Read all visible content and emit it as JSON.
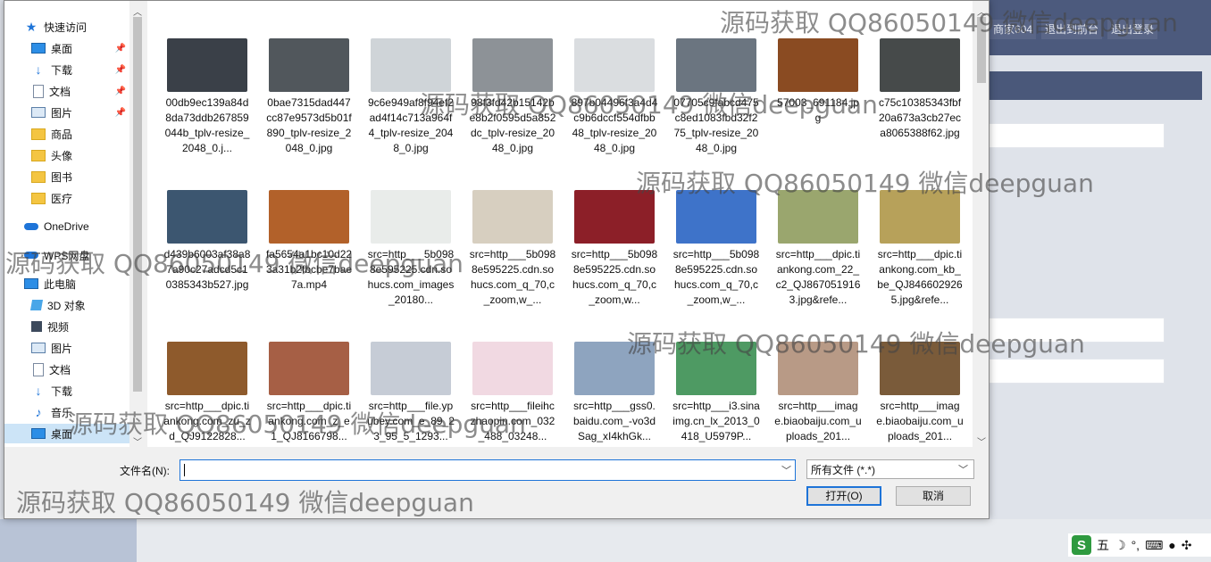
{
  "background": {
    "top_links": [
      "商家604",
      "退出到前台",
      "退出登录"
    ]
  },
  "nav": {
    "items": [
      {
        "label": "快速访问",
        "icon": "star-icon",
        "pinned": false
      },
      {
        "label": "桌面",
        "icon": "desktop-icon",
        "pinned": true
      },
      {
        "label": "下载",
        "icon": "download-icon",
        "pinned": true
      },
      {
        "label": "文档",
        "icon": "document-icon",
        "pinned": true
      },
      {
        "label": "图片",
        "icon": "pictures-icon",
        "pinned": true
      },
      {
        "label": "商品",
        "icon": "folder-icon",
        "pinned": false
      },
      {
        "label": "头像",
        "icon": "folder-icon",
        "pinned": false
      },
      {
        "label": "图书",
        "icon": "folder-icon",
        "pinned": false
      },
      {
        "label": "医疗",
        "icon": "folder-icon",
        "pinned": false
      },
      {
        "label": "OneDrive",
        "icon": "cloud-icon",
        "pinned": false
      },
      {
        "label": "WPS网盘",
        "icon": "cloud-drive-icon",
        "pinned": false
      },
      {
        "label": "此电脑",
        "icon": "computer-icon",
        "pinned": false
      },
      {
        "label": "3D 对象",
        "icon": "3d-objects-icon",
        "pinned": false
      },
      {
        "label": "视频",
        "icon": "video-icon",
        "pinned": false
      },
      {
        "label": "图片",
        "icon": "pictures-icon",
        "pinned": false
      },
      {
        "label": "文档",
        "icon": "document-icon",
        "pinned": false
      },
      {
        "label": "下载",
        "icon": "download-icon",
        "pinned": false
      },
      {
        "label": "音乐",
        "icon": "music-icon",
        "pinned": false
      },
      {
        "label": "桌面",
        "icon": "desktop-icon",
        "pinned": false
      }
    ]
  },
  "files": [
    {
      "name": "00db9ec139a84d8da73ddb267859044b_tplv-resize_2048_0.j...",
      "thumb": "#3a4048"
    },
    {
      "name": "0bae7315dad447cc87e9573d5b01f890_tplv-resize_2048_0.jpg",
      "thumb": "#51575c"
    },
    {
      "name": "9c6e949af8f94ef2ad4f14c713a964f4_tplv-resize_2048_0.jpg",
      "thumb": "#cfd4d8"
    },
    {
      "name": "98f3fd42b15142be8b2f0595d5a852dc_tplv-resize_2048_0.jpg",
      "thumb": "#8d9297"
    },
    {
      "name": "897b04496f3a4d4c9b6dccf554dfbb48_tplv-resize_2048_0.jpg",
      "thumb": "#dadde0"
    },
    {
      "name": "07705c9fabcd475c8ed1083fbd32f275_tplv-resize_2048_0.jpg",
      "thumb": "#6b7580"
    },
    {
      "name": "57003_691184.jpg",
      "thumb": "#8a4b22"
    },
    {
      "name": "c75c10385343fbf20a673a3cb27eca8065388f62.jpg",
      "thumb": "#464a4a"
    },
    {
      "name": "d439b6003af38a87a90c27adcd5c10385343b527.jpg",
      "thumb": "#3c5670"
    },
    {
      "name": "fa5654a1bc10d223a31b2fbcbe7bae7a.mp4",
      "thumb": "#b2612a"
    },
    {
      "name": "src=http___5b0988e595225.cdn.sohucs.com_images_20180...",
      "thumb": "#e9ecea"
    },
    {
      "name": "src=http___5b0988e595225.cdn.sohucs.com_q_70,c_zoom,w_...",
      "thumb": "#d7cfc0"
    },
    {
      "name": "src=http___5b0988e595225.cdn.sohucs.com_q_70,c_zoom,w...",
      "thumb": "#8c1f28"
    },
    {
      "name": "src=http___5b0988e595225.cdn.sohucs.com_q_70,c_zoom,w_...",
      "thumb": "#3e73c9"
    },
    {
      "name": "src=http___dpic.tiankong.com_22_c2_QJ8670519163.jpg&refe...",
      "thumb": "#9aa66e"
    },
    {
      "name": "src=http___dpic.tiankong.com_kb_be_QJ8466029265.jpg&refe...",
      "thumb": "#b7a15a"
    },
    {
      "name": "src=http___dpic.tiankong.com_zu_zd_QJ9122828...",
      "thumb": "#8e5a2c"
    },
    {
      "name": "src=http___dpic.tiankong.com_z_e1_QJ8166798...",
      "thumb": "#a65f45"
    },
    {
      "name": "src=http___file.ypubey.com_e_89_23_95_5_1293...",
      "thumb": "#c6ccd6"
    },
    {
      "name": "src=http___fileihczhaopin.com_032_488_03248...",
      "thumb": "#f1d9e2"
    },
    {
      "name": "src=http___gss0.baidu.com_-vo3dSag_xI4khGk...",
      "thumb": "#8ea4bf"
    },
    {
      "name": "src=http___i3.sinaimg.cn_lx_2013_0418_U5979P...",
      "thumb": "#4e9a63"
    },
    {
      "name": "src=http___image.biaobaiju.com_uploads_201...",
      "thumb": "#b89a86"
    },
    {
      "name": "src=http___image.biaobaiju.com_uploads_201...",
      "thumb": "#7a5b3a"
    }
  ],
  "footer": {
    "filename_label": "文件名(N):",
    "filename_value": "",
    "filter_value": "所有文件 (*.*)",
    "open_label": "打开(O)",
    "cancel_label": "取消"
  },
  "ime": {
    "label": "五"
  },
  "watermarks": [
    "源码获取 QQ86050149 微信deepguan",
    "源码获取 QQ86050149 微信deepguan",
    "源码获取 QQ86050149 微信deepguan",
    "源码获取 QQ86050149 微信deepguan",
    "源码获取 QQ86050149 微信deepguan",
    "源码获取 QQ86050149 微信deepguan",
    "源码获取 QQ86050149 微信deepguan"
  ]
}
